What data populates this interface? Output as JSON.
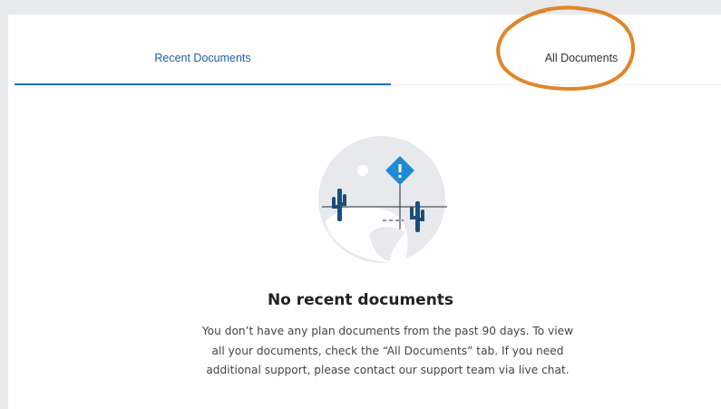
{
  "tabs": {
    "recent_label": "Recent Documents",
    "all_label": "All Documents"
  },
  "empty_state": {
    "title": "No recent documents",
    "message": "You don’t have any plan documents from the past 90 days. To view all your documents, check the “All Documents” tab. If you need additional support, please contact our support team via live chat."
  },
  "colors": {
    "accent": "#1f6fc4",
    "warning_diamond": "#1f8ad6",
    "cactus": "#1b4f7a",
    "annotation": "#e0862a"
  },
  "icons": {
    "illustration": "desert-cactus-warning-icon"
  }
}
